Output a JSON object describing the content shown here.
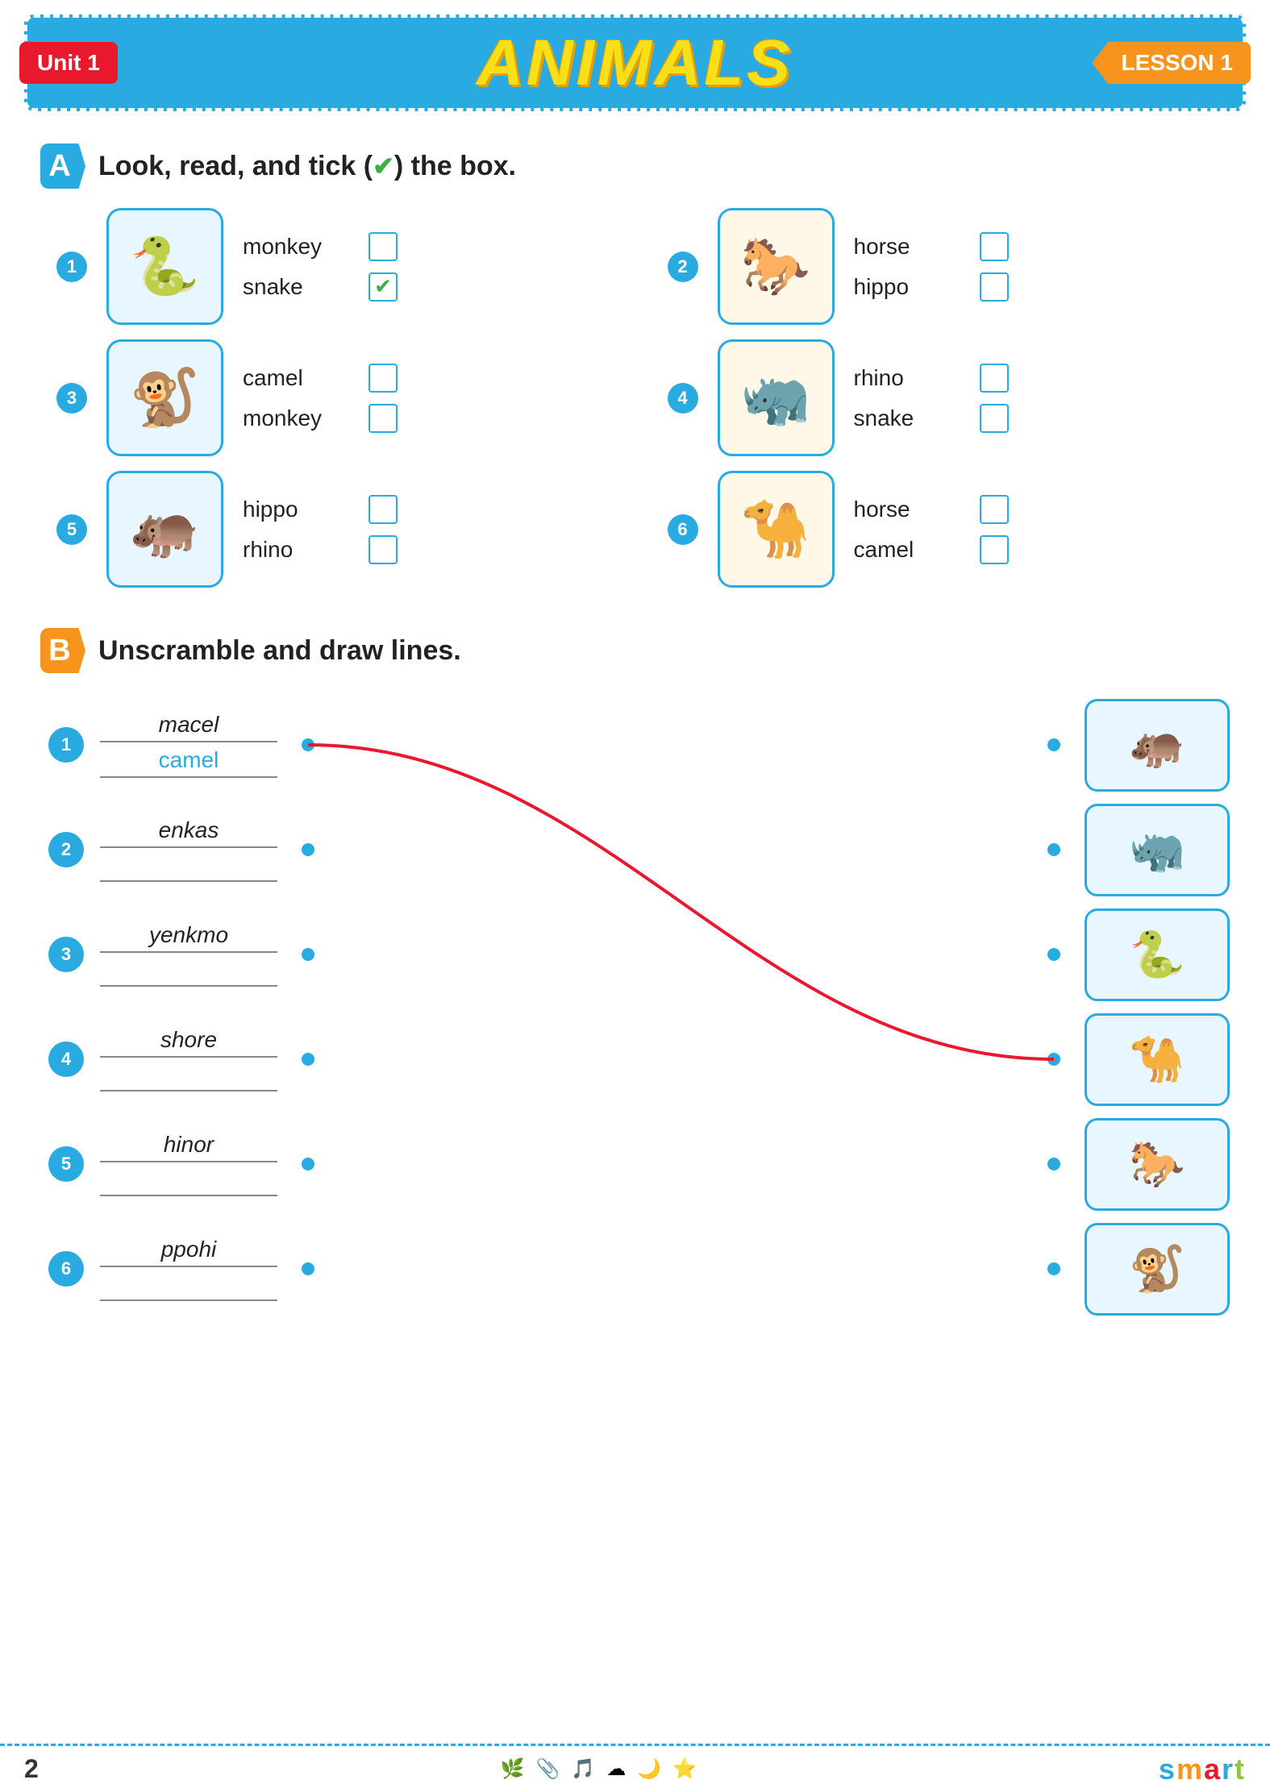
{
  "header": {
    "unit_label": "Unit 1",
    "title": "ANIMALS",
    "lesson_label": "LESSON  1"
  },
  "section_a": {
    "letter": "A",
    "instruction": "Look, read, and tick (",
    "checkmark": "✔",
    "instruction_end": ") the box.",
    "items": [
      {
        "number": "1",
        "emoji": "🐍",
        "bg": "#e8f6ff",
        "options": [
          {
            "label": "monkey",
            "checked": false
          },
          {
            "label": "snake",
            "checked": true
          }
        ]
      },
      {
        "number": "2",
        "emoji": "🐎",
        "bg": "#fff8e8",
        "options": [
          {
            "label": "horse",
            "checked": false
          },
          {
            "label": "hippo",
            "checked": false
          }
        ]
      },
      {
        "number": "3",
        "emoji": "🐒",
        "bg": "#e8f6ff",
        "options": [
          {
            "label": "camel",
            "checked": false
          },
          {
            "label": "monkey",
            "checked": false
          }
        ]
      },
      {
        "number": "4",
        "emoji": "🦏",
        "bg": "#fff8e8",
        "options": [
          {
            "label": "rhino",
            "checked": false
          },
          {
            "label": "snake",
            "checked": false
          }
        ]
      },
      {
        "number": "5",
        "emoji": "🦛",
        "bg": "#e8f6ff",
        "options": [
          {
            "label": "hippo",
            "checked": false
          },
          {
            "label": "rhino",
            "checked": false
          }
        ]
      },
      {
        "number": "6",
        "emoji": "🐪",
        "bg": "#fff8e8",
        "options": [
          {
            "label": "horse",
            "checked": false
          },
          {
            "label": "camel",
            "checked": false
          }
        ]
      }
    ]
  },
  "section_b": {
    "letter": "B",
    "instruction": "Unscramble and draw lines.",
    "rows": [
      {
        "number": "1",
        "scrambled": "macel",
        "answer": "camel",
        "emoji": "🦛"
      },
      {
        "number": "2",
        "scrambled": "enkas",
        "answer": "",
        "emoji": "🦏"
      },
      {
        "number": "3",
        "scrambled": "yenkmo",
        "answer": "",
        "emoji": "🐍"
      },
      {
        "number": "4",
        "scrambled": "shore",
        "answer": "",
        "emoji": "🐪"
      },
      {
        "number": "5",
        "scrambled": "hinor",
        "answer": "",
        "emoji": "🐎"
      },
      {
        "number": "6",
        "scrambled": "ppohi",
        "answer": "",
        "emoji": "🐒"
      }
    ]
  },
  "footer": {
    "page": "2",
    "brand": "smart"
  }
}
